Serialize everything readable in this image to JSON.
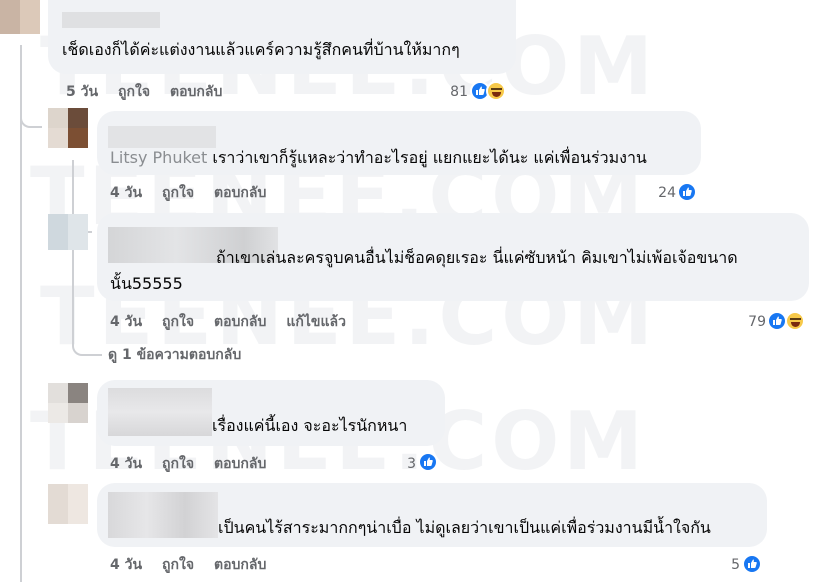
{
  "watermark": "TEENEE.COM",
  "colors": {
    "like": "#1877f2",
    "meta": "#65676b",
    "bubble": "#f0f2f5"
  },
  "actions": {
    "like": "ถูกใจ",
    "reply": "ตอบกลับ",
    "edited": "แก้ไขแล้ว"
  },
  "comments": [
    {
      "name_prefix": "",
      "text": "เช็ดเองก็ได้ค่ะแต่งงานแล้วแคร์ความรู้สึกคนที่บ้านให้มากๆ",
      "text2": "",
      "time": "5 วัน",
      "count": "81",
      "reactions": [
        "like-icon",
        "haha-icon"
      ]
    },
    {
      "name_prefix": "Litsy Phuket",
      "text": "เราว่าเขาก็รู้แหละว่าทำอะไรอยู่ แยกแยะได้นะ แค่เพื่อนร่วมงาน",
      "text2": "",
      "time": "4 วัน",
      "count": "24",
      "reactions": [
        "like-icon"
      ]
    },
    {
      "name_prefix": "",
      "text": "ถ้าเขาเล่นละครจูบคนอื่นไม่ช็อคดุยเรอะ นี่แค่ซับหน้า คิมเขาไม่เพ้อเจ้อขนาด",
      "text2": "นั้น55555",
      "time": "4 วัน",
      "edited": true,
      "count": "79",
      "reactions": [
        "like-icon",
        "haha-icon"
      ]
    },
    {
      "name_prefix": "",
      "text": "เรื่องแค่นี้เอง จะอะไรนักหนา",
      "text2": "",
      "time": "4 วัน",
      "count": "3",
      "reactions": [
        "like-icon"
      ]
    },
    {
      "name_prefix": "",
      "text": "เป็นคนไร้สาระมากกๆน่าเบื่อ ไม่ดูเลยว่าเขาเป็นแค่เพื่อร่วมงานมีน้ำใจกัน",
      "text2": "",
      "time": "4 วัน",
      "count": "5",
      "reactions": [
        "like-icon"
      ]
    }
  ],
  "view_replies": "ดู 1 ข้อความตอบกลับ"
}
